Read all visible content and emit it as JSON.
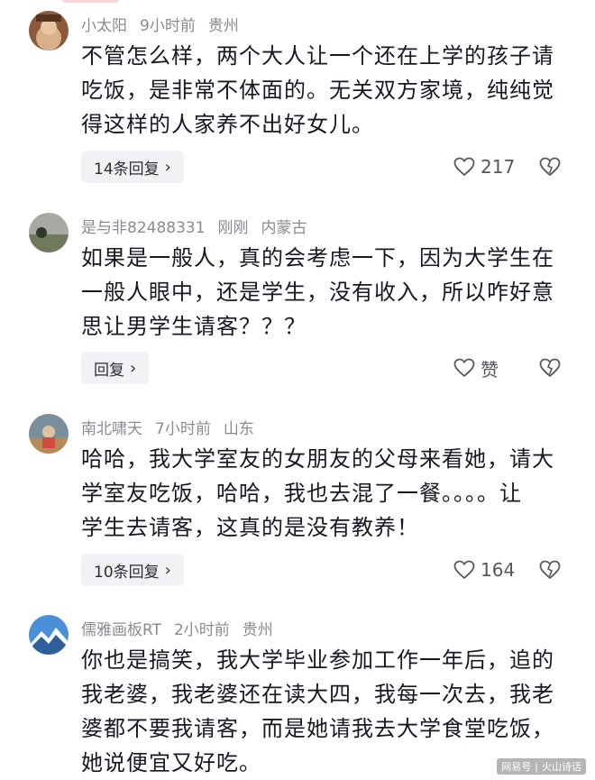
{
  "comments": [
    {
      "username": "小太阳",
      "time": "9小时前",
      "location": "贵州",
      "lines": [
        "不管怎么样，两个大人让一个还在上学的孩子请",
        "吃饭，是非常不体面的。无关双方家境，纯纯觉",
        "得这样的人家养不出好女儿。"
      ],
      "reply_label": "14条回复",
      "likes": "217"
    },
    {
      "username": "是与非82488331",
      "time": "刚刚",
      "location": "内蒙古",
      "lines": [
        "如果是一般人，真的会考虑一下，因为大学生在",
        "一般人眼中，还是学生，没有收入，所以咋好意",
        "思让男学生请客？？？"
      ],
      "reply_label": "回复",
      "likes": "赞"
    },
    {
      "username": "南北啸天",
      "time": "7小时前",
      "location": "山东",
      "lines": [
        "哈哈，我大学室友的女朋友的父母来看她，请大",
        "学室友吃饭，哈哈，我也去混了一餐。。。。让",
        "学生去请客，这真的是没有教养！"
      ],
      "reply_label": "10条回复",
      "likes": "164"
    },
    {
      "username": "儒雅画板RT",
      "time": "2小时前",
      "location": "贵州",
      "lines": [
        "你也是搞笑，我大学毕业参加工作一年后，追的",
        "我老婆，我老婆还在读大四，我每一次去，我老",
        "婆都不要我请客，而是她请我去大学食堂吃饭，",
        "她说便宜又好吃。"
      ]
    }
  ],
  "icons": {
    "reply_chevron": "chevron-right-icon",
    "like": "heart-outline-icon",
    "dislike": "broken-heart-icon"
  },
  "watermark": {
    "left": "网易号",
    "right": "火山诗话"
  }
}
